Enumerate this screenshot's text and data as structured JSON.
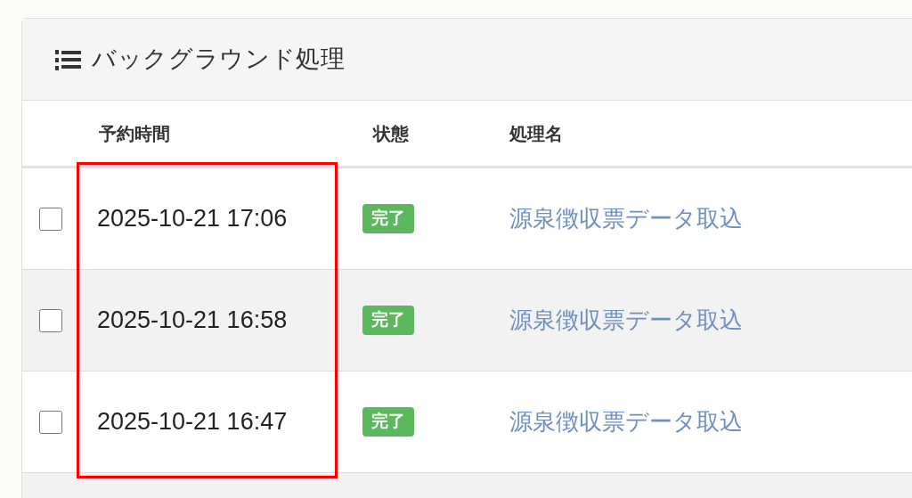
{
  "panel": {
    "title": "バックグラウンド処理"
  },
  "table": {
    "columns": [
      {
        "label": "予約時間"
      },
      {
        "label": "状態"
      },
      {
        "label": "処理名"
      }
    ],
    "rows": [
      {
        "checked": false,
        "time": "2025-10-21 17:06",
        "status": "完了",
        "name": "源泉徴収票データ取込"
      },
      {
        "checked": false,
        "time": "2025-10-21 16:58",
        "status": "完了",
        "name": "源泉徴収票データ取込"
      },
      {
        "checked": false,
        "time": "2025-10-21 16:47",
        "status": "完了",
        "name": "源泉徴収票データ取込"
      }
    ]
  },
  "annotation": {
    "kind": "frame"
  }
}
